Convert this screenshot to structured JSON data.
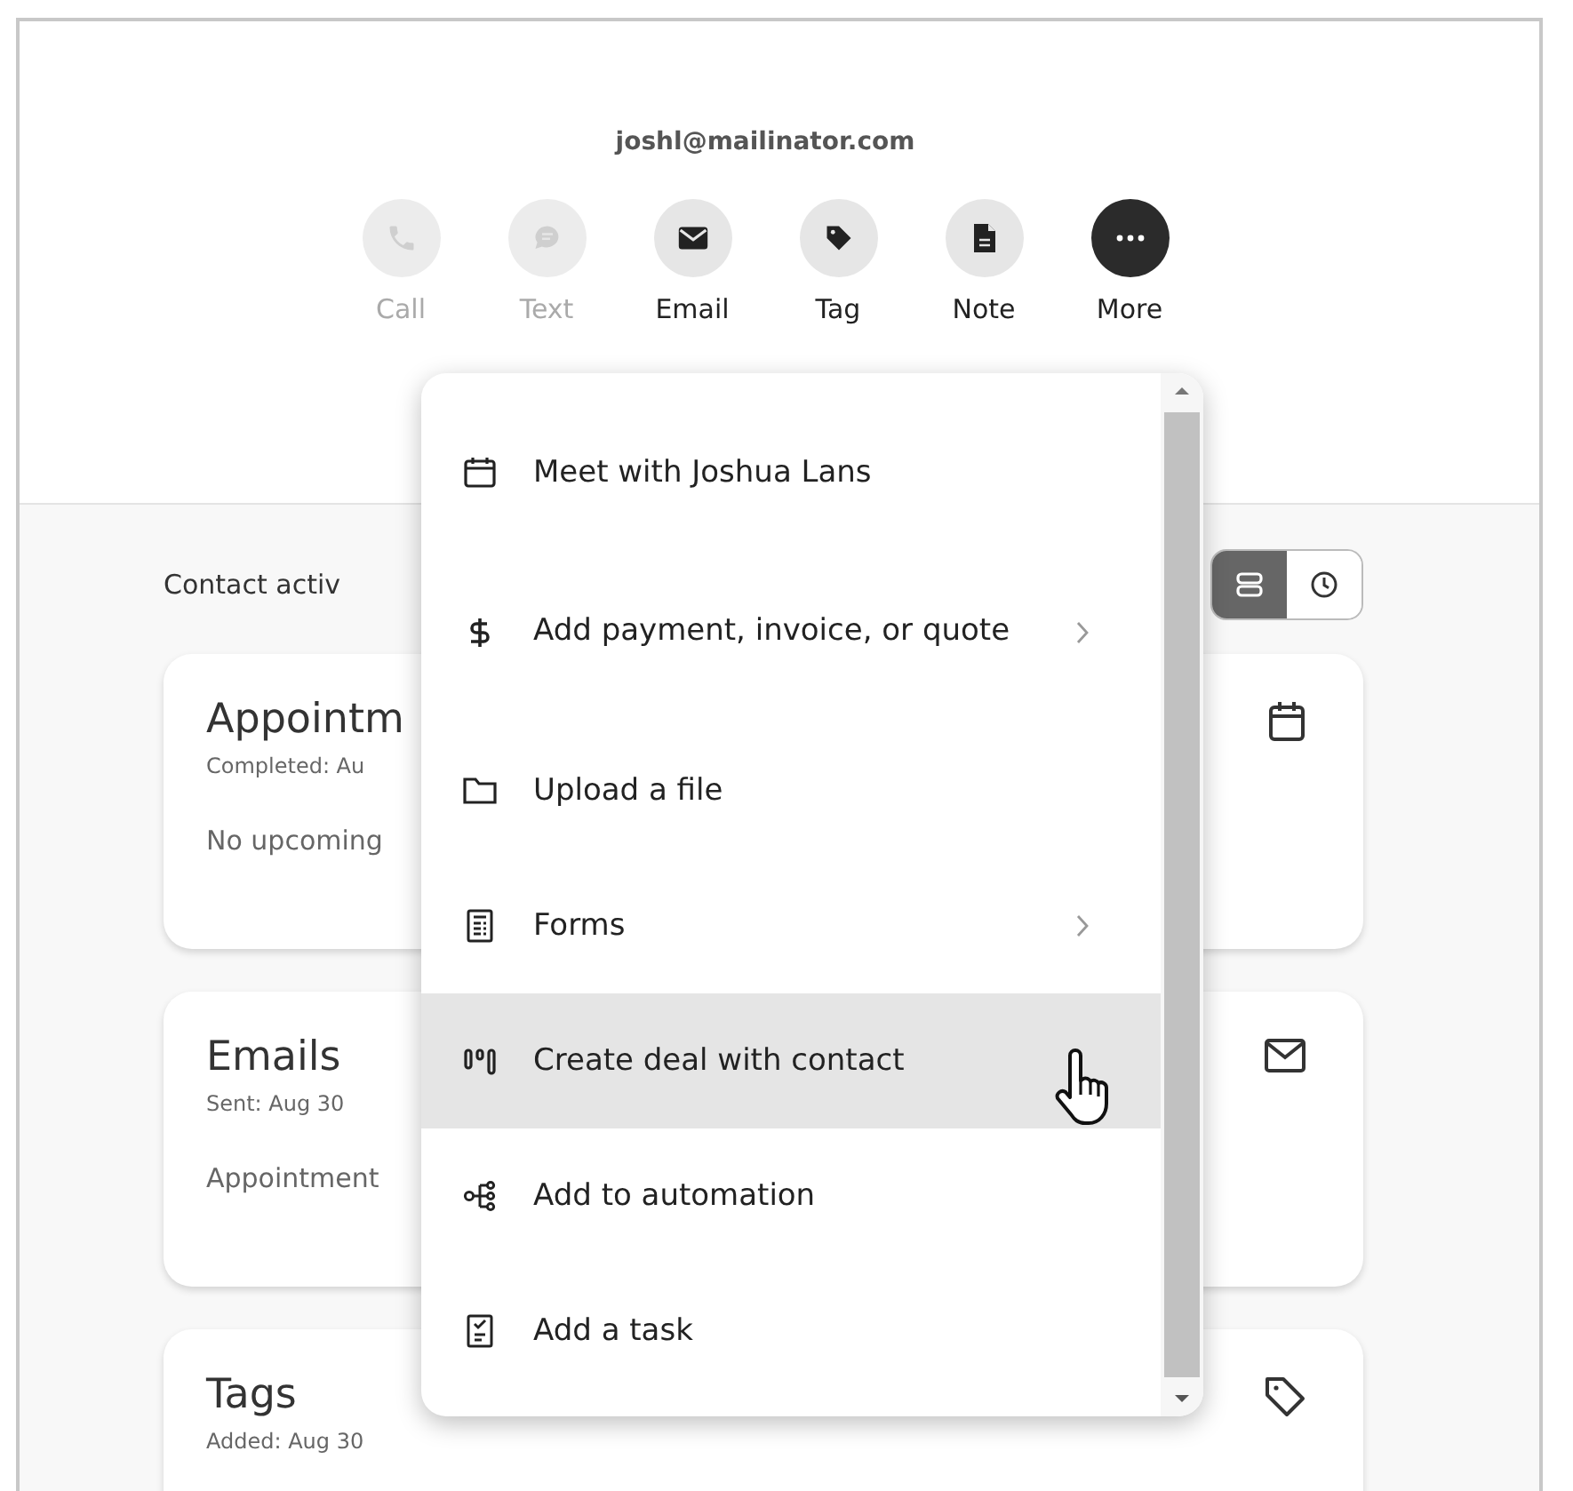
{
  "contact": {
    "email": "joshl@mailinator.com"
  },
  "actions": [
    {
      "label": "Call",
      "disabled": true
    },
    {
      "label": "Text",
      "disabled": true
    },
    {
      "label": "Email",
      "disabled": false
    },
    {
      "label": "Tag",
      "disabled": false
    },
    {
      "label": "Note",
      "disabled": false
    },
    {
      "label": "More",
      "disabled": false,
      "selected": true
    }
  ],
  "activity": {
    "label": "Contact activ",
    "views": [
      {
        "selected": true
      },
      {
        "selected": false
      }
    ]
  },
  "cards": [
    {
      "title": "Appointm",
      "subtitle": "Completed: Au",
      "body": "No upcoming"
    },
    {
      "title": "Emails",
      "subtitle": "Sent: Aug 30",
      "body": "Appointment"
    },
    {
      "title": "Tags",
      "subtitle": "Added: Aug 30"
    }
  ],
  "menu": {
    "items": [
      {
        "label": "Meet with Joshua Lans",
        "has_submenu": false,
        "highlighted": false
      },
      {
        "label": "Add payment, invoice, or quote",
        "has_submenu": true,
        "highlighted": false
      },
      {
        "label": "Upload a file",
        "has_submenu": false,
        "highlighted": false
      },
      {
        "label": "Forms",
        "has_submenu": true,
        "highlighted": false
      },
      {
        "label": "Create deal with contact",
        "has_submenu": false,
        "highlighted": true
      },
      {
        "label": "Add to automation",
        "has_submenu": false,
        "highlighted": false
      },
      {
        "label": "Add a task",
        "has_submenu": false,
        "highlighted": false
      }
    ]
  }
}
